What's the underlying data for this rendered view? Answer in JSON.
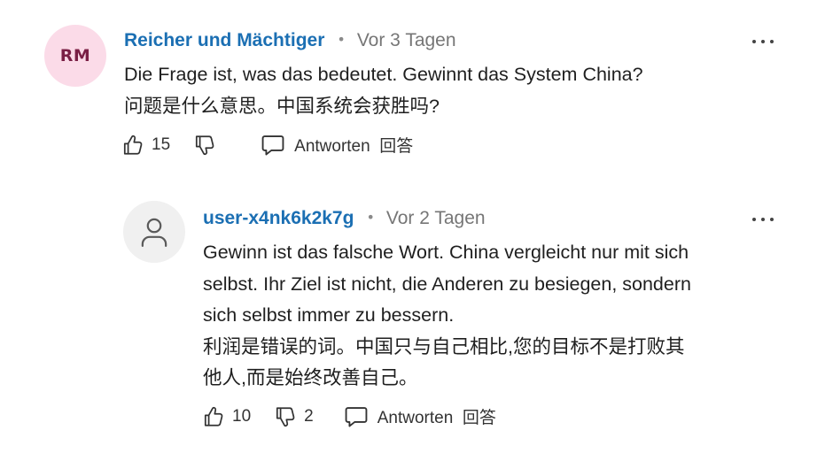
{
  "comments": [
    {
      "avatar_initials": "RM",
      "author": "Reicher und Mächtiger",
      "separator": "•",
      "time": "Vor 3 Tagen",
      "lines": [
        "Die Frage ist, was das bedeutet. Gewinnt das System China?",
        "问题是什么意思。中国系统会获胜吗?"
      ],
      "likes": "15",
      "dislikes": "",
      "reply_label": "Antworten  回答",
      "icons": {
        "like": "thumbs-up-icon",
        "dislike": "thumbs-down-icon",
        "reply": "comment-bubble-icon",
        "more": "more-options-icon"
      }
    },
    {
      "avatar_icon": "user-icon",
      "author": "user-x4nk6k2k7g",
      "separator": "•",
      "time": "Vor 2 Tagen",
      "lines": [
        "Gewinn ist das falsche Wort. China vergleicht nur mit sich",
        "selbst. Ihr Ziel ist nicht, die Anderen zu besiegen, sondern",
        "sich selbst immer zu bessern.",
        "利润是错误的词。中国只与自己相比,您的目标不是打败其",
        "他人,而是始终改善自己。"
      ],
      "likes": "10",
      "dislikes": "2",
      "reply_label": "Antworten  回答",
      "icons": {
        "like": "thumbs-up-icon",
        "dislike": "thumbs-down-icon",
        "reply": "comment-bubble-icon",
        "more": "more-options-icon"
      }
    }
  ],
  "colors": {
    "author": "#1b6fb3",
    "timestamp": "#767676",
    "avatar_rm_bg": "#fbdbe8",
    "avatar_rm_text": "#7a1f45",
    "avatar_user_bg": "#f0f0f0"
  }
}
